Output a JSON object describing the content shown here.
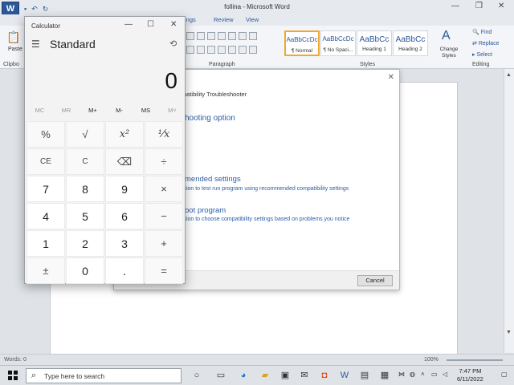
{
  "word": {
    "title": "follina - Microsoft Word",
    "tabs": [
      "ings",
      "Review",
      "View"
    ],
    "clipboard": {
      "paste": "Paste",
      "group": "Clipbo"
    },
    "paragraph_group": "Paragraph",
    "styles_group": "Styles",
    "editing_group": "Editing",
    "styles": [
      {
        "preview": "AaBbCcDc",
        "name": "¶ Normal"
      },
      {
        "preview": "AaBbCcDc",
        "name": "¶ No Spaci..."
      },
      {
        "preview": "AaBbCc",
        "name": "Heading 1"
      },
      {
        "preview": "AaBbCc",
        "name": "Heading 2"
      }
    ],
    "change_styles": "Change Styles",
    "editing": {
      "find": "Find",
      "replace": "Replace",
      "select": "Select"
    },
    "status": {
      "words": "Words: 0",
      "zoom": "100%"
    }
  },
  "troubleshooter": {
    "title": "patibility Troubleshooter",
    "option_heading": "hooting option",
    "link1": "mended settings",
    "desc1": "tion to test run program using recommended compatibility settings",
    "link2": "oot program",
    "desc2": "tion to choose compatibility settings based on problems you notice",
    "cancel": "Cancel"
  },
  "calculator": {
    "title": "Calculator",
    "mode": "Standard",
    "display": "0",
    "memory": [
      "MC",
      "MR",
      "M+",
      "M-",
      "MS",
      "M˅"
    ],
    "keys": [
      "%",
      "√",
      "x²",
      "¹⁄x",
      "CE",
      "C",
      "⌫",
      "÷",
      "7",
      "8",
      "9",
      "×",
      "4",
      "5",
      "6",
      "−",
      "1",
      "2",
      "3",
      "+",
      "±",
      "0",
      ".",
      "="
    ]
  },
  "taskbar": {
    "search_placeholder": "Type here to search",
    "time": "7:47 PM",
    "date": "6/11/2022"
  }
}
